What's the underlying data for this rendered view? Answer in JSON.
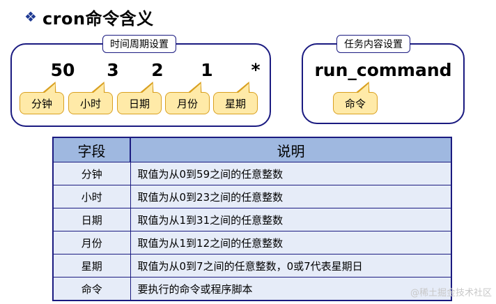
{
  "title": {
    "icon": "diamond-bullet-icon",
    "text": "cron命令含义"
  },
  "time_group": {
    "label": "时间周期设置",
    "fields": [
      {
        "value": "50",
        "tag": "分钟"
      },
      {
        "value": "3",
        "tag": "小时"
      },
      {
        "value": "2",
        "tag": "日期"
      },
      {
        "value": "1",
        "tag": "月份"
      },
      {
        "value": "*",
        "tag": "星期"
      }
    ]
  },
  "task_group": {
    "label": "任务内容设置",
    "command": "run_command",
    "tag": "命令"
  },
  "table": {
    "headers": [
      "字段",
      "说明"
    ],
    "rows": [
      [
        "分钟",
        "取值为从0到59之间的任意整数"
      ],
      [
        "小时",
        "取值为从0到23之间的任意整数"
      ],
      [
        "日期",
        "取值为从1到31之间的任意整数"
      ],
      [
        "月份",
        "取值为从1到12之间的任意整数"
      ],
      [
        "星期",
        "取值为从0到7之间的任意整数，0或7代表星期日"
      ],
      [
        "命令",
        "要执行的命令或程序脚本"
      ]
    ]
  },
  "watermark": "@稀土掘金技术社区",
  "colors": {
    "border": "#1a1a80",
    "tag_fill": "#ffeaa8",
    "header_fill": "#9fb8e0",
    "row_fill": "#e6ecf8"
  }
}
